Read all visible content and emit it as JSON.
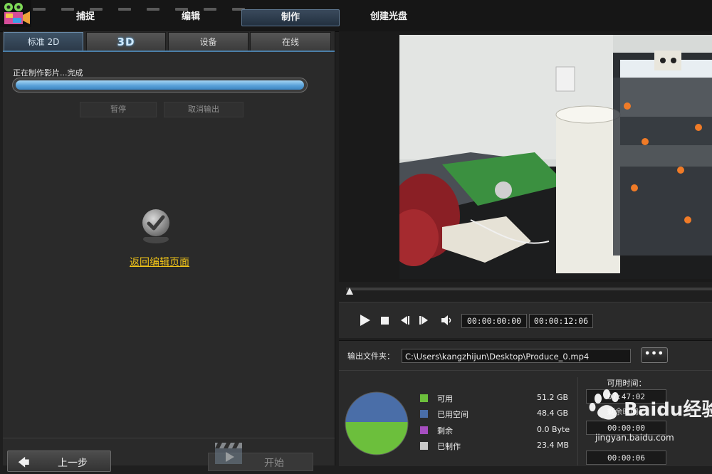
{
  "header": {
    "modes": [
      "捕捉",
      "编辑",
      "制作",
      "创建光盘"
    ],
    "active_mode": "制作"
  },
  "left": {
    "tabs": [
      "标准 2D",
      "3D",
      "设备",
      "在线"
    ],
    "active_tab": "标准 2D",
    "status_text": "正在制作影片...完成",
    "progress": 1.0,
    "pause_label": "暂停",
    "cancel_label": "取消输出",
    "back_link": "返回编辑页面",
    "prev_label": "上一步",
    "start_label": "开始"
  },
  "player": {
    "time_current": "00:00:00:00",
    "time_total": "00:00:12:06",
    "seek_position": 0
  },
  "output": {
    "folder_label": "输出文件夹：",
    "path": "C:\\Users\\kangzhijun\\Desktop\\Produce_0.mp4",
    "browse_label": "•••"
  },
  "disk": {
    "legend": [
      {
        "name": "可用",
        "value": "51.2 GB",
        "color": "#6cbf3c"
      },
      {
        "name": "已用空间",
        "value": "48.4 GB",
        "color": "#4a6ea8"
      },
      {
        "name": "剩余",
        "value": "0.0 Byte",
        "color": "#a64ec0"
      },
      {
        "name": "已制作",
        "value": "23.4 MB",
        "color": "#c8c8c8"
      }
    ],
    "avail_time_label": "可用时间：",
    "time_avail": "07:47:02",
    "remaining_time_label": "剩余时间：",
    "time_remaining": "00:00:00",
    "time_produced": "00:00:06"
  },
  "watermark": {
    "brand": "Baidu经验",
    "url": "jingyan.baidu.com"
  }
}
